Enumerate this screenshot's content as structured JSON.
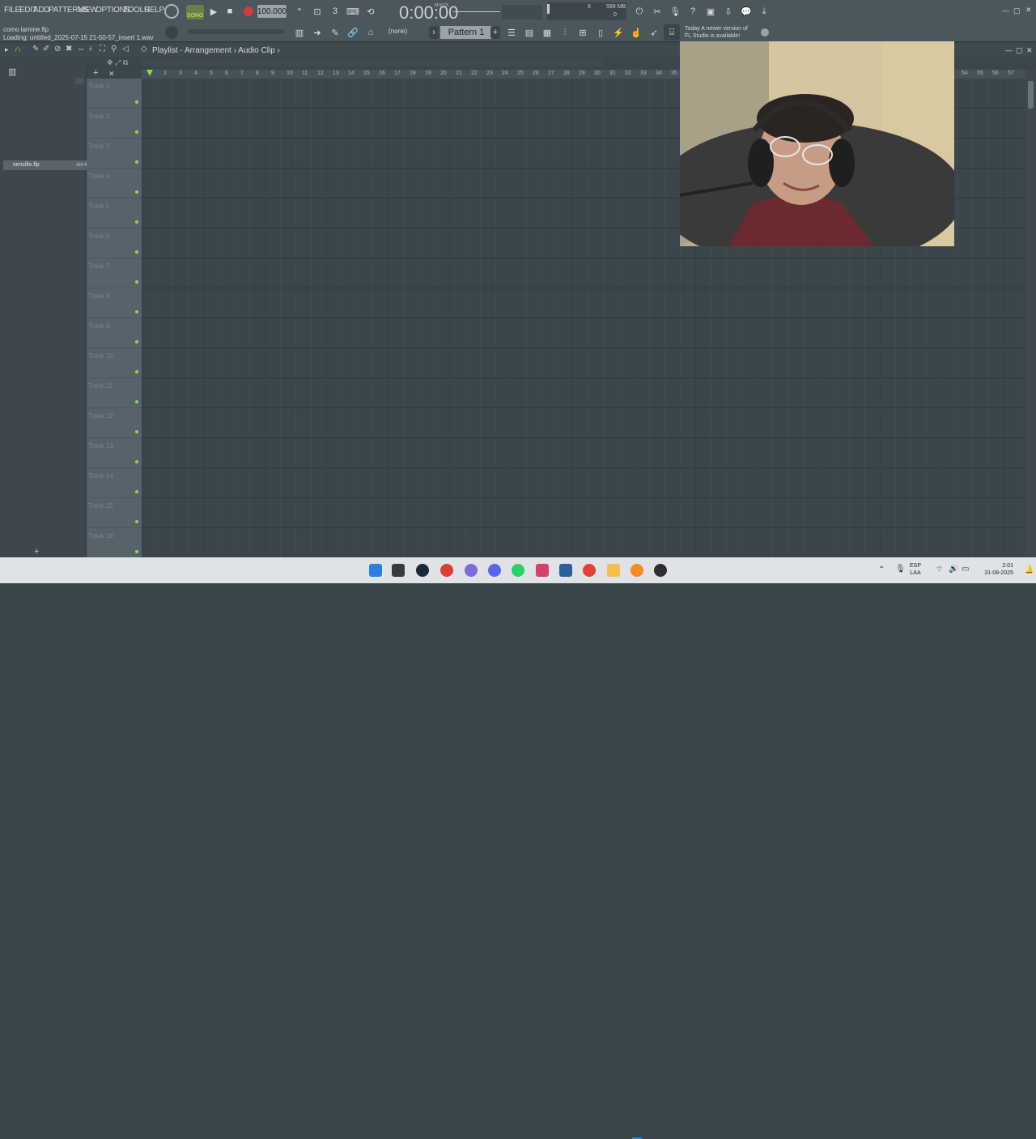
{
  "menu": [
    "FILE",
    "EDIT",
    "ADD",
    "PATTERNS",
    "VIEW",
    "OPTIONS",
    "TOOLS",
    "HELP"
  ],
  "transport": {
    "mode": "SONG",
    "tempo": "100.000",
    "time": "0:00:00",
    "time_label": "M:S:CS",
    "cpu_value": "6",
    "memory": "599 MB",
    "polyphony": "0"
  },
  "hint": {
    "line1": "como lamine.flp",
    "line2": "Loading: untitled_2025-07-15 21-50-57_insert 1.wav"
  },
  "pattern": {
    "selector": "Pattern 1",
    "snap": "(none)"
  },
  "news": {
    "label": "Today",
    "line1": "A newer version of",
    "line2": "FL Studio is available!"
  },
  "playlist": {
    "breadcrumb": [
      "Playlist - Arrangement",
      "Audio Clip"
    ],
    "picker_item": "sencillo.flp",
    "picker_shortcut": "Alt+4",
    "tracks": [
      "Track 3",
      "Track 2",
      "Track 3",
      "Track 4",
      "Track 5",
      "Track 6",
      "Track 7",
      "Track 8",
      "Track 9",
      "Track 10",
      "Track 11",
      "Track 12",
      "Track 13",
      "Track 14",
      "Track 15",
      "Track 16"
    ],
    "ruler": [
      "2",
      "3",
      "4",
      "5",
      "6",
      "7",
      "8",
      "9",
      "10",
      "11",
      "12",
      "13",
      "14",
      "15",
      "16",
      "17",
      "18",
      "19",
      "20",
      "21",
      "22",
      "23",
      "24",
      "25",
      "26",
      "27",
      "28",
      "29",
      "30",
      "31",
      "32",
      "33",
      "34",
      "35",
      "54",
      "55",
      "56",
      "57"
    ]
  },
  "taskbar": {
    "lang_1": "ESP",
    "lang_2": "LAA",
    "time": "2:01",
    "date": "31-08-2025"
  },
  "colors": {
    "track_dot": "#8fd64b",
    "record": "#d43b3b",
    "song_mode": "#c9f06b"
  }
}
